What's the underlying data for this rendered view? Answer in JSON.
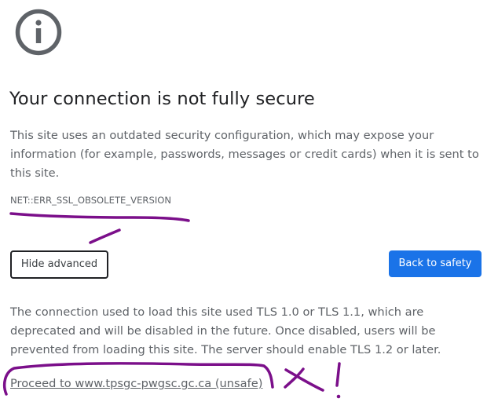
{
  "header": {
    "icon": "info-circle-icon"
  },
  "main": {
    "title": "Your connection is not fully secure",
    "description": "This site uses an outdated security configuration, which may expose your information (for example, passwords, messages or credit cards) when it is sent to this site.",
    "error_code": "NET::ERR_SSL_OBSOLETE_VERSION",
    "details": "The connection used to load this site used TLS 1.0 or TLS 1.1, which are deprecated and will be disabled in the future. Once disabled, users will be prevented from loading this site. The server should enable TLS 1.2 or later.",
    "proceed_link": "Proceed to www.tpsgc-pwgsc.gc.ca (unsafe)"
  },
  "buttons": {
    "hide_advanced": "Hide advanced",
    "back_to_safety": "Back to safety"
  },
  "colors": {
    "primary_button": "#1a73e8",
    "annotation_ink": "#7b0f8a",
    "body_text": "#5f6368",
    "title_text": "#202124"
  }
}
